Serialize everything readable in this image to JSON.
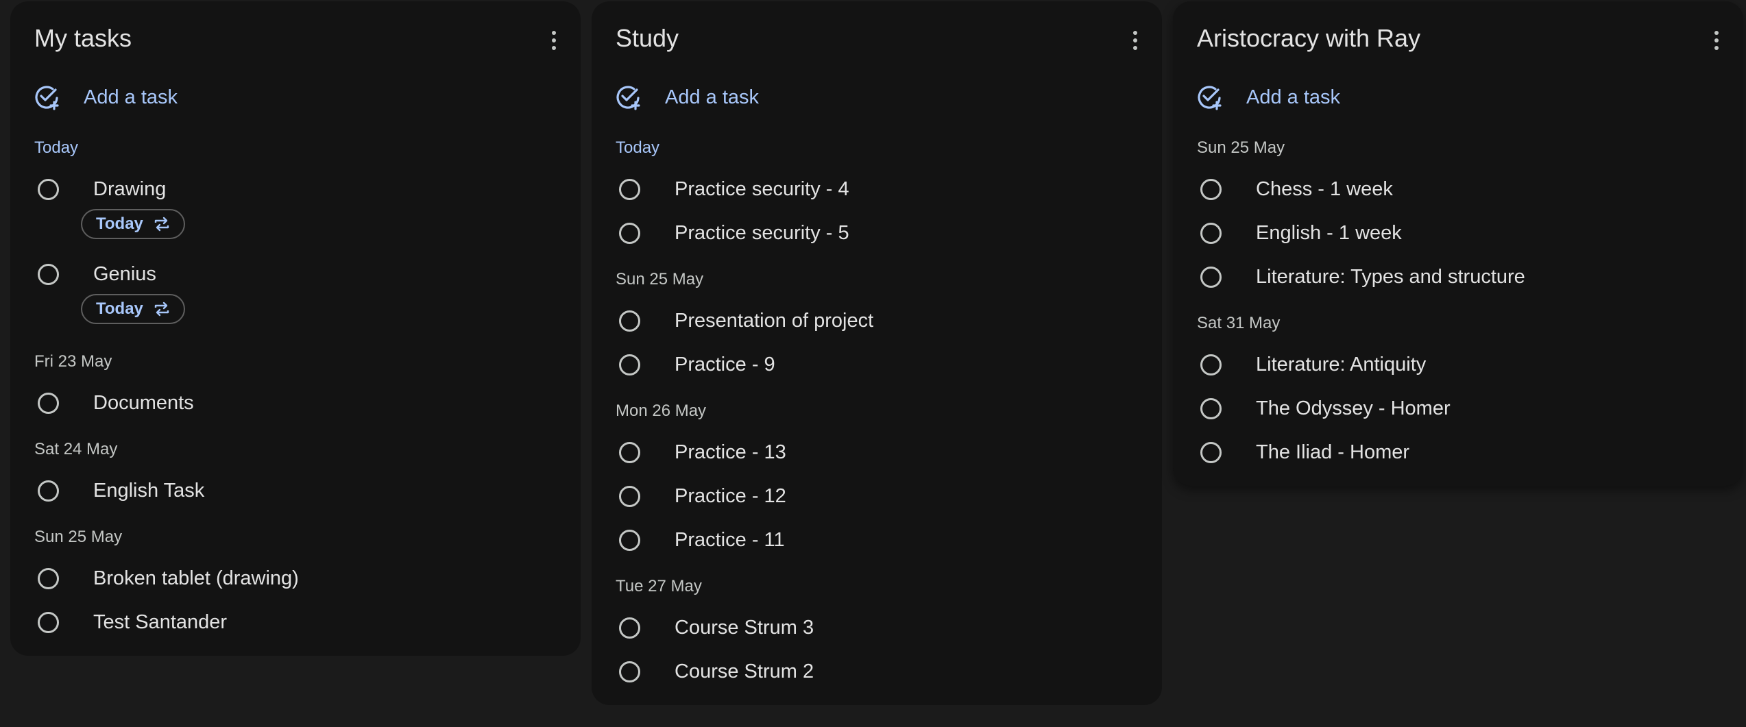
{
  "lists": [
    {
      "title": "My tasks",
      "add_task": "Add a task",
      "sections": [
        {
          "header": "Today",
          "accent": true,
          "tasks": [
            {
              "title": "Drawing",
              "chip": "Today",
              "repeat": true
            },
            {
              "title": "Genius",
              "chip": "Today",
              "repeat": true
            }
          ]
        },
        {
          "header": "Fri 23 May",
          "tasks": [
            {
              "title": "Documents"
            }
          ]
        },
        {
          "header": "Sat 24 May",
          "tasks": [
            {
              "title": "English Task"
            }
          ]
        },
        {
          "header": "Sun 25 May",
          "tasks": [
            {
              "title": "Broken tablet (drawing)"
            },
            {
              "title": "Test Santander"
            }
          ]
        }
      ]
    },
    {
      "title": "Study",
      "add_task": "Add a task",
      "sections": [
        {
          "header": "Today",
          "accent": true,
          "tasks": [
            {
              "title": "Practice security - 4"
            },
            {
              "title": "Practice security - 5"
            }
          ]
        },
        {
          "header": "Sun 25 May",
          "tasks": [
            {
              "title": "Presentation of project"
            },
            {
              "title": "Practice - 9"
            }
          ]
        },
        {
          "header": "Mon 26 May",
          "tasks": [
            {
              "title": "Practice - 13"
            },
            {
              "title": "Practice - 12"
            },
            {
              "title": "Practice - 11"
            }
          ]
        },
        {
          "header": "Tue 27 May",
          "tasks": [
            {
              "title": "Course Strum 3"
            },
            {
              "title": "Course Strum 2"
            }
          ]
        }
      ]
    },
    {
      "title": "Aristocracy with Ray",
      "add_task": "Add a task",
      "sections": [
        {
          "header": "Sun 25 May",
          "tasks": [
            {
              "title": "Chess - 1 week"
            },
            {
              "title": "English - 1 week"
            },
            {
              "title": "Literature: Types and structure"
            }
          ]
        },
        {
          "header": "Sat 31 May",
          "tasks": [
            {
              "title": "Literature: Antiquity"
            },
            {
              "title": "The Odyssey - Homer"
            },
            {
              "title": "The Iliad - Homer"
            }
          ]
        }
      ]
    }
  ],
  "icons": {
    "add_task": "add-task-icon",
    "menu": "more-vert-icon",
    "repeat": "repeat-icon",
    "checkbox": "radio-circle-icon"
  },
  "colors": {
    "background": "#1b1b1b",
    "card": "#131313",
    "accent": "#a8c7fa",
    "text": "#e3e3e3",
    "muted": "#c4c7c5"
  }
}
